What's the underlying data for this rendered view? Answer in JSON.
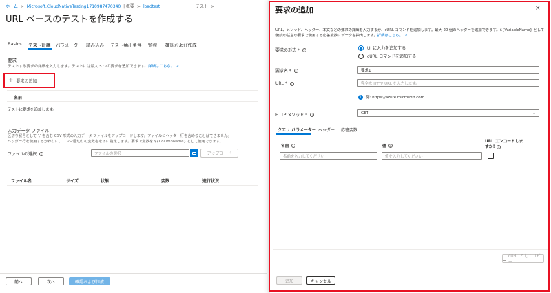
{
  "breadcrumb": {
    "home": "ホーム",
    "sep1": ">",
    "resource": "Microsoft.CloudNativeTesting1710987470340",
    "sep2": "| 概要",
    "sep3": ">",
    "loadtest": "loadtest",
    "sep4": "| テスト",
    "sep5": ">"
  },
  "page": {
    "title": "URL ベースのテストを作成する",
    "more": "···"
  },
  "tabs": [
    "Basics",
    "テスト計画",
    "パラメーター",
    "読み込み",
    "テスト抽出条件",
    "監視",
    "確認および作成"
  ],
  "requests": {
    "heading": "要求",
    "description": "テストする要求の詳細を入力します。テストには最大 5 つの要求を追加できます。",
    "learn_more": "詳細はこちら。",
    "add_button": "要求の追加",
    "column_name": "名前",
    "empty": "テストに要求を追加します。"
  },
  "input_file": {
    "heading": "入力データ ファイル",
    "description": "区切り記号として ',' を含む CSV 形式の入力データ ファイルをアップロードします。ファイルにヘッダー行を含めることはできません。ヘッダー行を使用するかわりに、コンマ区切りの変数名を下に指定します。要求で変数を ${ColumnName} として使用できます。",
    "select_label": "ファイルの選択",
    "select_placeholder": "ファイルの選択",
    "upload_button": "アップロード",
    "columns": [
      "ファイル名",
      "サイズ",
      "状態",
      "変数",
      "進行状況"
    ]
  },
  "footer": {
    "prev": "前へ",
    "next": "次へ",
    "create": "確認および作成"
  },
  "panel": {
    "title": "要求の追加",
    "close": "×",
    "description": "URL、メソッド、ヘッダー、本文などの要求の詳細を入力するか、cURL コマンドを追加します。最大 20 個のヘッダーを追加できます。${VariableName} として後続の任意の要求で使用する応答変数にデータを抽出します。",
    "learn_more": "詳細はこちら。",
    "format_label": "要求の形式 *",
    "format_options": [
      "UI に入力を追加する",
      "cURL コマンドを追加する"
    ],
    "name_label": "要求名 *",
    "name_value": "要求1",
    "url_label": "URL *",
    "url_placeholder": "完全な HTTP URL を入力します。",
    "url_hint": "例: https://azure.microsoft.com",
    "method_label": "HTTP メソッド *",
    "method_value": "GET",
    "subtabs": [
      "クエリ パラメーター",
      "ヘッダー",
      "応答変数"
    ],
    "qp_name_header": "名前",
    "qp_value_header": "値",
    "qp_encode_header": "URL エンコードしますか?",
    "qp_name_placeholder": "名前を入力してください",
    "qp_value_placeholder": "値を入力してください",
    "curl_copy": "cURL としてコピー",
    "add_button": "追加",
    "cancel_button": "キャンセル"
  },
  "colors": {
    "accent": "#0078d4",
    "highlight": "#e81123"
  }
}
